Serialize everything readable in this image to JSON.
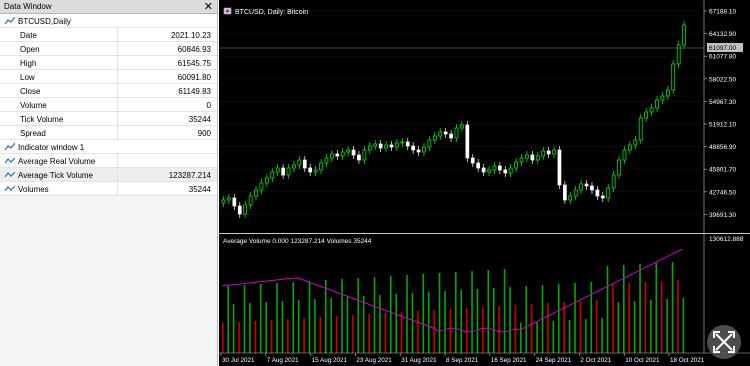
{
  "data_window": {
    "title": "Data Window",
    "symbol_row": "BTCUSD,Daily",
    "rows": [
      {
        "label": "Date",
        "value": "2021.10.23"
      },
      {
        "label": "Open",
        "value": "60846.93"
      },
      {
        "label": "High",
        "value": "61545.75"
      },
      {
        "label": "Low",
        "value": "60091.80"
      },
      {
        "label": "Close",
        "value": "61149.83"
      },
      {
        "label": "Volume",
        "value": "0"
      },
      {
        "label": "Tick Volume",
        "value": "35244"
      },
      {
        "label": "Spread",
        "value": "900"
      }
    ],
    "indicator_header": "Indicator window 1",
    "indicators": [
      {
        "label": "Average Real Volume",
        "value": ""
      },
      {
        "label": "Average Tick Volume",
        "value": "123287.214"
      },
      {
        "label": "Volumes",
        "value": "35244"
      }
    ]
  },
  "main_chart": {
    "title": "BTCUSD, Daily: Bitcoin",
    "price_labels": [
      "67188.10",
      "64132.90",
      "61077.80",
      "58022.50",
      "54967.30",
      "51912.10",
      "48856.90",
      "45801.70",
      "42746.50",
      "39691.30"
    ],
    "current_price": "61097.00",
    "colors": {
      "bull": "#00ff00",
      "bear": "#ffffff",
      "bg": "#000000",
      "grid": "#404040"
    }
  },
  "indicator_chart": {
    "title": "Average Volume 0.000 123287.214 Volumes 35244",
    "scale_top": "130612.888",
    "colors": {
      "line": "#cc00cc",
      "up_bar": "#00aa00",
      "down_bar": "#cc0000"
    }
  },
  "time_axis": [
    "30 Jul 2021",
    "7 Aug 2021",
    "15 Aug 2021",
    "23 Aug 2021",
    "31 Aug 2021",
    "8 Sep 2021",
    "16 Sep 2021",
    "24 Sep 2021",
    "2 Oct 2021",
    "10 Oct 2021",
    "18 Oct 2021"
  ]
}
